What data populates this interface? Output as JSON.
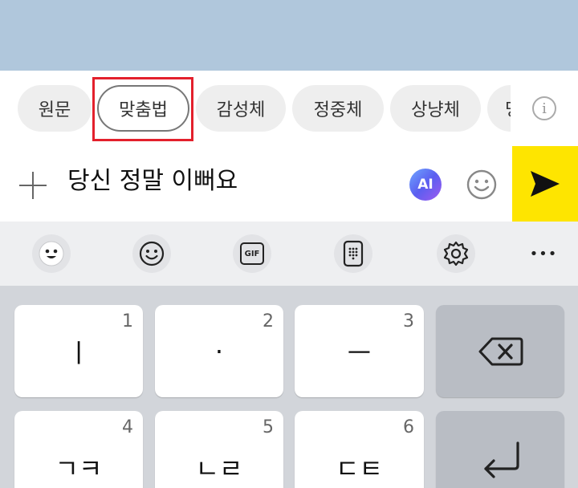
{
  "suggestions": {
    "chips": [
      {
        "label": "원문"
      },
      {
        "label": "맞춤법",
        "selected": true
      },
      {
        "label": "감성체"
      },
      {
        "label": "정중체"
      },
      {
        "label": "상냥체"
      },
      {
        "label": "명"
      }
    ],
    "info_icon_glyph": "i"
  },
  "input": {
    "message": "당신 정말 이뻐요",
    "ai_label": "AI"
  },
  "toolbar": {
    "gif_label": "GIF",
    "more_label": "•••"
  },
  "keyboard": {
    "keys": [
      {
        "num": "1",
        "glyph": "ㅣ"
      },
      {
        "num": "2",
        "glyph": "·"
      },
      {
        "num": "3",
        "glyph": "ㅡ"
      },
      {
        "num": "4",
        "glyph": "ㄱㅋ"
      },
      {
        "num": "5",
        "glyph": "ㄴㄹ"
      },
      {
        "num": "6",
        "glyph": "ㄷㅌ"
      }
    ]
  },
  "colors": {
    "send_button": "#fee500",
    "highlight_box": "#e3202c",
    "header_bg": "#b0c7dc"
  }
}
